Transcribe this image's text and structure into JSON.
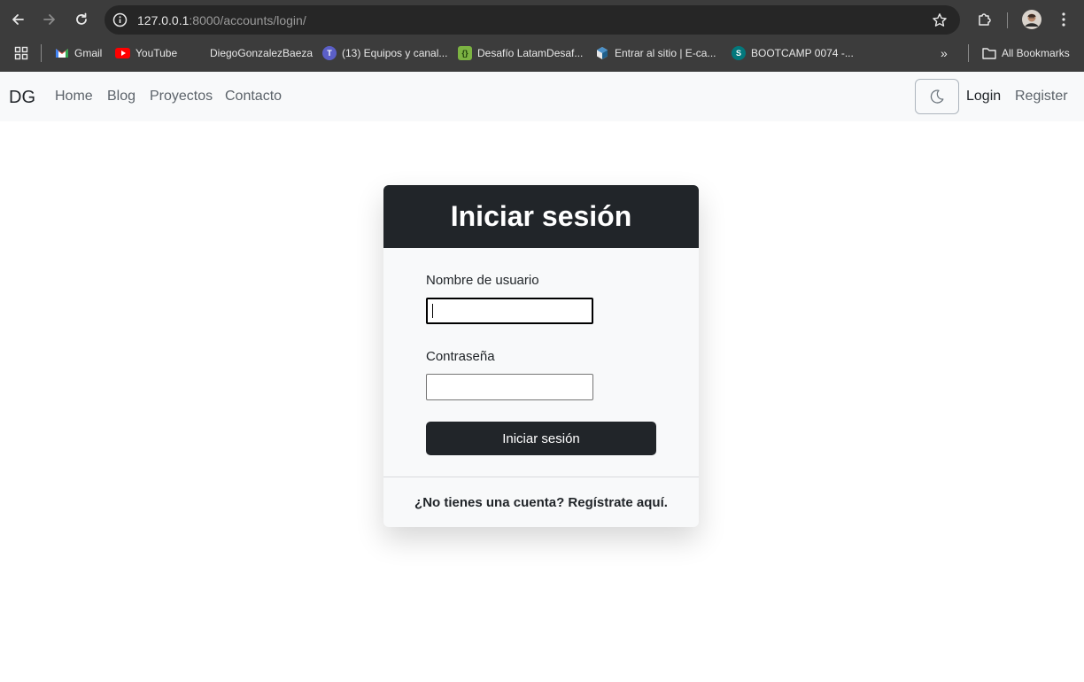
{
  "browser": {
    "url_host": "127.0.0.1",
    "url_rest": ":8000/accounts/login/",
    "bookmarks": [
      {
        "label": "Gmail",
        "icon": "gmail-icon"
      },
      {
        "label": "YouTube",
        "icon": "youtube-icon"
      },
      {
        "label": "DiegoGonzalezBaeza",
        "icon": ""
      },
      {
        "label": "(13) Equipos y canal...",
        "icon": "teams-icon"
      },
      {
        "label": "Desafío LatamDesaf...",
        "icon": "desafio-icon"
      },
      {
        "label": "Entrar al sitio | E-ca...",
        "icon": "moodle-icon"
      },
      {
        "label": "BOOTCAMP 0074 -...",
        "icon": "sharepoint-icon"
      }
    ],
    "all_bookmarks_label": "All Bookmarks"
  },
  "navbar": {
    "brand": "DG",
    "links": [
      "Home",
      "Blog",
      "Proyectos",
      "Contacto"
    ],
    "login": "Login",
    "register": "Register"
  },
  "login_card": {
    "title": "Iniciar sesión",
    "username_label": "Nombre de usuario",
    "username_value": "",
    "password_label": "Contraseña",
    "password_value": "",
    "submit_label": "Iniciar sesión",
    "footer_text": "¿No tienes una cuenta? Regístrate aquí."
  },
  "colors": {
    "chrome_bg": "#3c3c3c",
    "navbar_bg": "#f8f9fa",
    "card_header_bg": "#212529",
    "button_bg": "#212529"
  }
}
